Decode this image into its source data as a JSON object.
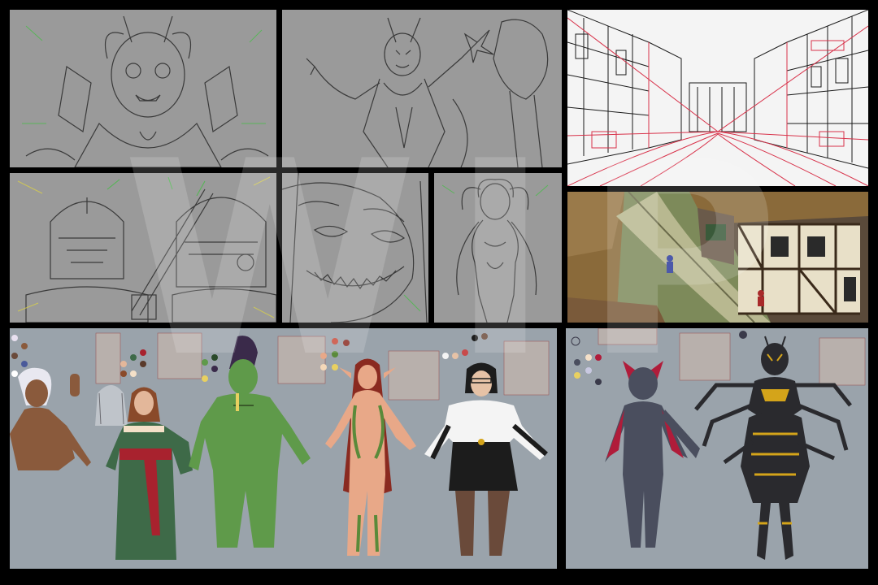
{
  "watermark": {
    "text": "WIP"
  },
  "colors": {
    "background": "#000000",
    "sketch_panel": "#9a9a9a",
    "sheet_panel": "#9aa3ab",
    "layout_red": "#d8324a",
    "guide_green": "#3fbf3f",
    "guide_yellow": "#d9d04a"
  },
  "panels": [
    {
      "id": "horned-girl-sketch",
      "kind": "sketch"
    },
    {
      "id": "demon-sketch",
      "kind": "sketch"
    },
    {
      "id": "street-layout",
      "kind": "layout"
    },
    {
      "id": "knights-sketch",
      "kind": "sketch"
    },
    {
      "id": "grin-closeup-sketch",
      "kind": "sketch"
    },
    {
      "id": "pose-sketch",
      "kind": "sketch"
    },
    {
      "id": "village-render",
      "kind": "render"
    },
    {
      "id": "character-sheet-main",
      "kind": "character-sheet"
    },
    {
      "id": "character-sheet-creatures",
      "kind": "character-sheet"
    }
  ],
  "characters": [
    {
      "id": "dark-elf",
      "skin": "#8a5a3c",
      "hair": "#e8e8f0"
    },
    {
      "id": "ghost",
      "skin": "#c8ccd2",
      "hair": "#6a6a70"
    },
    {
      "id": "noble-lady",
      "skin": "#e3b79a",
      "dress": "#3e6a48",
      "sash": "#a8222e",
      "hair": "#8a4a2a"
    },
    {
      "id": "orc",
      "skin": "#5f9a4a",
      "hair": "#3a2a4a"
    },
    {
      "id": "dryad",
      "skin": "#e8a888",
      "hair": "#8a2a20",
      "vines": "#5a8a3a"
    },
    {
      "id": "office-woman",
      "skin": "#e6c2a6",
      "shirt": "#f4f4f4",
      "skirt": "#1c1c1c",
      "hair": "#1c1c1c",
      "legs": "#6a4a3a"
    },
    {
      "id": "bat-girl",
      "skin": "#4a4e5e",
      "wings": "#b01c3a"
    },
    {
      "id": "wasp-woman",
      "body": "#2a2a2e",
      "stripes": "#d4a41a"
    }
  ],
  "palettes": [
    [
      "#ffffff",
      "#6a4a3a",
      "#8a5a3c",
      "#e8e0f0",
      "#4a5a9a"
    ],
    [
      "#e3b79a",
      "#3e6a48",
      "#a8222e",
      "#8a4a2a",
      "#f4e0c8",
      "#5a3a2a"
    ],
    [
      "#5f9a4a",
      "#3a2a4a",
      "#e8d060",
      "#2a4a2a"
    ],
    [
      "#e8a888",
      "#8a2a20",
      "#5a8a3a",
      "#f4d8b8",
      "#c84a3a"
    ],
    [
      "#e6c2a6",
      "#1c1c1c",
      "#f4f4f4",
      "#c84a4a",
      "#6a4a3a"
    ],
    [
      "#4a4e5e",
      "#b01c3a",
      "#f4e0c8",
      "#e8d060",
      "#c8c8e0",
      "#3a3a4a"
    ]
  ]
}
